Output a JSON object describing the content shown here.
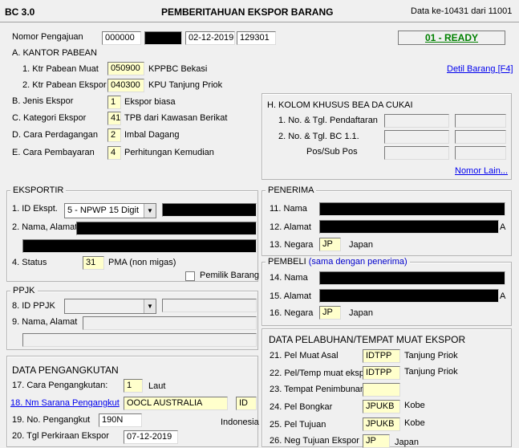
{
  "header": {
    "doc_code": "BC 3.0",
    "title": "PEMBERITAHUAN EKSPOR BARANG",
    "data_of": "Data ke-10431 dari 11001"
  },
  "pengajuan": {
    "label": "Nomor Pengajuan",
    "part1": "000000",
    "date": "02-12-2019",
    "part3": "129301",
    "status": "01 - READY"
  },
  "kantor": {
    "section": "A. KANTOR PABEAN",
    "muat_label": "1. Ktr Pabean Muat",
    "muat_code": "050900",
    "muat_name": "KPPBC Bekasi",
    "ekspor_label": "2. Ktr Pabean Ekspor",
    "ekspor_code": "040300",
    "ekspor_name": "KPU Tanjung Priok",
    "detil_link": "Detil Barang [F4]"
  },
  "jenis": {
    "label": "B. Jenis Ekspor",
    "code": "1",
    "name": "Ekspor biasa"
  },
  "kategori": {
    "label": "C. Kategori Ekspor",
    "code": "41",
    "name": "TPB dari Kawasan Berikat"
  },
  "perdagangan": {
    "label": "D. Cara Perdagangan",
    "code": "2",
    "name": "Imbal Dagang"
  },
  "pembayaran": {
    "label": "E. Cara Pembayaran",
    "code": "4",
    "name": "Perhitungan Kemudian"
  },
  "kolom_khusus": {
    "legend": "H. KOLOM KHUSUS BEA DA CUKAI",
    "pendaftaran": "1. No. & Tgl. Pendaftaran",
    "bc11": "2. No. & Tgl. BC 1.1.",
    "pos": "Pos/Sub Pos",
    "nomor_lain": "Nomor Lain..."
  },
  "eksportir": {
    "legend": "EKSPORTIR",
    "id_label": "1. ID Ekspt.",
    "id_type": "5 - NPWP 15 Digit",
    "nama_label": "2. Nama, Alamat",
    "status_label": "4. Status",
    "status_code": "31",
    "status_name": "PMA (non migas)",
    "pemilik_label": "Pemilik Barang"
  },
  "penerima": {
    "legend": "PENERIMA",
    "nama_label": "11. Nama",
    "alamat_label": "12. Alamat",
    "alamat_tail": "A",
    "negara_label": "13. Negara",
    "negara_code": "JP",
    "negara_name": "Japan"
  },
  "pembeli": {
    "legend": "PEMBELI",
    "same_note": "(sama dengan penerima)",
    "nama_label": "14. Nama",
    "alamat_label": "15. Alamat",
    "alamat_tail": "A",
    "negara_label": "16. Negara",
    "negara_code": "JP",
    "negara_name": "Japan"
  },
  "ppjk": {
    "legend": "PPJK",
    "id_label": "8. ID PPJK",
    "nama_label": "9. Nama, Alamat"
  },
  "pengangkutan": {
    "section": "DATA PENGANGKUTAN",
    "cara_label": "17. Cara Pengangkutan:",
    "cara_code": "1",
    "cara_name": "Laut",
    "sarana_label": "18. Nm Sarana Pengangkut",
    "sarana_value": "OOCL AUSTRALIA",
    "sarana_flag": "ID",
    "no_label": "19. No. Pengangkut",
    "no_value": "190N",
    "no_country": "Indonesia",
    "tgl_label": "20. Tgl Perkiraan Ekspor",
    "tgl_value": "07-12-2019"
  },
  "pelabuhan": {
    "section": "DATA PELABUHAN/TEMPAT MUAT EKSPOR",
    "asal_label": "21. Pel Muat Asal",
    "asal_code": "IDTPP",
    "asal_name": "Tanjung Priok",
    "temp_label": "22. Pel/Temp muat eksp",
    "temp_code": "IDTPP",
    "temp_name": "Tanjung Priok",
    "timbun_label": "23. Tempat Penimbunan",
    "bongkar_label": "24. Pel Bongkar",
    "bongkar_code": "JPUKB",
    "bongkar_name": "Kobe",
    "tujuan_label": "25. Pel Tujuan",
    "tujuan_code": "JPUKB",
    "tujuan_name": "Kobe",
    "neg_label": "26. Neg Tujuan Ekspor",
    "neg_code": "JP",
    "neg_name": "Japan"
  }
}
